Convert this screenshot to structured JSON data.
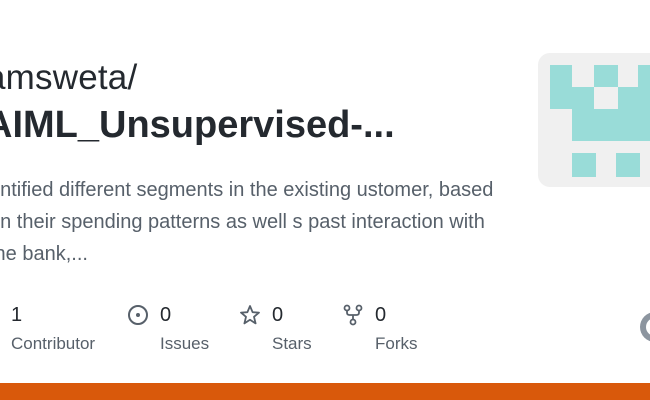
{
  "repo": {
    "owner": "amsweta/",
    "name": "AIML_Unsupervised-...",
    "description": "entified different segments in the existing ustomer, based on their spending patterns as well s past interaction with the bank,..."
  },
  "stats": [
    {
      "value": "1",
      "label": "Contributor",
      "icon": "people-icon"
    },
    {
      "value": "0",
      "label": "Issues",
      "icon": "issue-opened-icon"
    },
    {
      "value": "0",
      "label": "Stars",
      "icon": "star-icon"
    },
    {
      "value": "0",
      "label": "Forks",
      "icon": "repo-forked-icon"
    }
  ],
  "colors": {
    "accent_bar": "#d9590b",
    "avatar_pixel": "#99dcd8",
    "avatar_background": "#f0f0f0",
    "title_text": "#24292f",
    "muted_text": "#57606a"
  }
}
